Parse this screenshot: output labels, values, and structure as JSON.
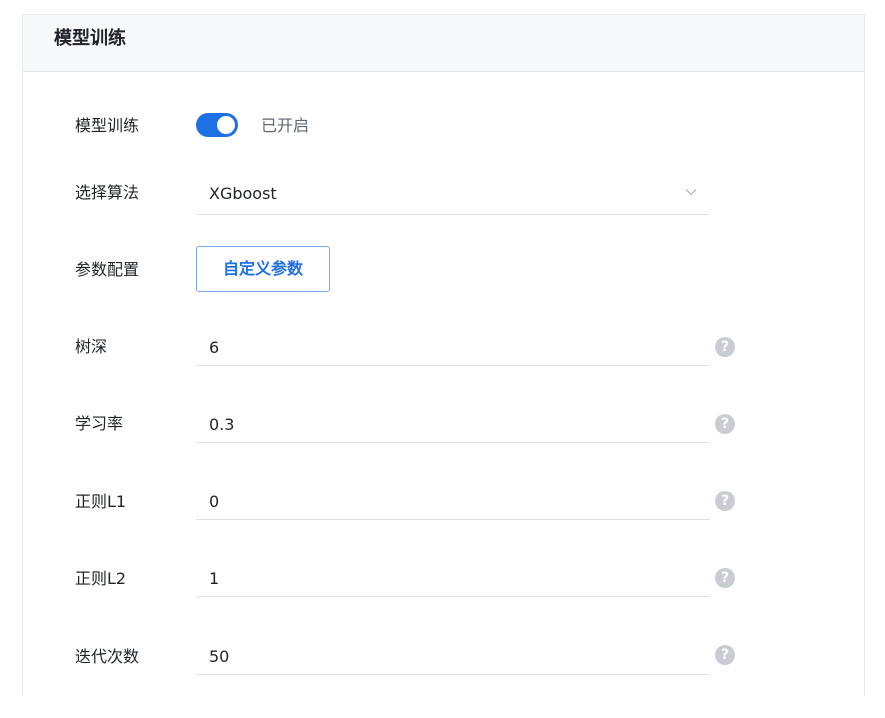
{
  "panel": {
    "title": "模型训练"
  },
  "training": {
    "label": "模型训练",
    "toggle_on": true,
    "status": "已开启"
  },
  "algorithm": {
    "label": "选择算法",
    "value": "XGboost"
  },
  "params_config": {
    "label": "参数配置",
    "button_label": "自定义参数"
  },
  "params": [
    {
      "label": "树深",
      "value": "6"
    },
    {
      "label": "学习率",
      "value": "0.3"
    },
    {
      "label": "正则L1",
      "value": "0"
    },
    {
      "label": "正则L2",
      "value": "1"
    },
    {
      "label": "迭代次数",
      "value": "50"
    }
  ],
  "help_glyph": "?",
  "colors": {
    "accent": "#1f6fe5",
    "help_icon": "#c9cdd3",
    "header_bg": "#f7f8fa"
  },
  "icons": {
    "select": "chevron-down-icon",
    "help": "question-circle-icon"
  }
}
